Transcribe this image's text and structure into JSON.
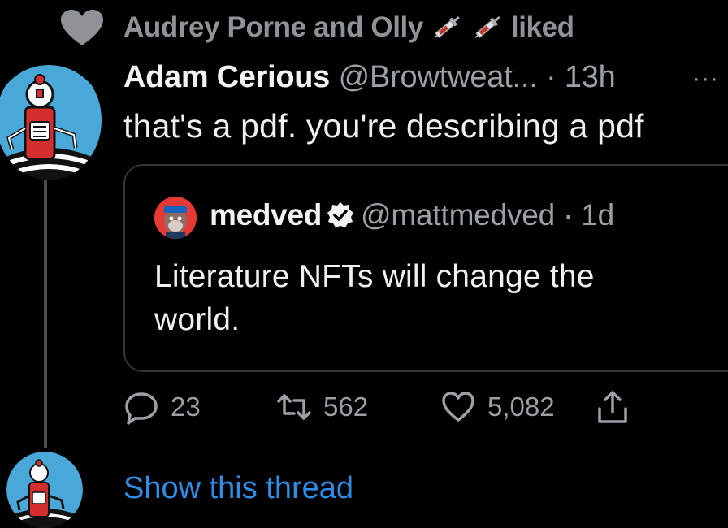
{
  "social_context": {
    "icon": "heart-icon",
    "names": "Audrey Porne and Olly",
    "emoji": [
      "syringe",
      "syringe"
    ],
    "action": "liked"
  },
  "tweet": {
    "display_name": "Adam Cerious",
    "handle": "@Browtweat...",
    "separator": " · ",
    "time": "13h",
    "more": "···",
    "text": "that's a pdf. you're describing a pdf"
  },
  "quote": {
    "display_name": "medved",
    "verified": true,
    "handle": "@mattmedved",
    "separator": " · ",
    "time": "1d",
    "text": "Literature NFTs will change the world."
  },
  "actions": {
    "replies": "23",
    "retweets": "562",
    "likes": "5,082"
  },
  "show_thread": "Show this thread",
  "colors": {
    "background": "#000000",
    "text_primary": "#eef0f2",
    "text_secondary": "#9aa0a6",
    "link": "#2e8ee6",
    "border": "#2f3336",
    "avatar_bg": "#4aa8d8"
  }
}
